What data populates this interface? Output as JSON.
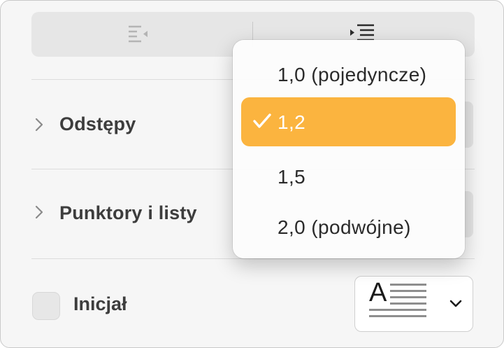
{
  "indent": {
    "decrease_icon": "decrease-indent-icon",
    "increase_icon": "increase-indent-icon"
  },
  "sections": [
    {
      "label": "Odstępy",
      "icon": "chevron-right-icon"
    },
    {
      "label": "Punktory i listy",
      "icon": "chevron-right-icon"
    }
  ],
  "initial": {
    "label": "Inicjał",
    "checked": false,
    "style_preview_letter": "A",
    "dropdown_icon": "chevron-down-icon"
  },
  "spacing_menu": {
    "items": [
      {
        "label": "1,0 (pojedyncze)",
        "selected": false
      },
      {
        "label": "1,2",
        "selected": true
      },
      {
        "label": "1,5",
        "selected": false
      },
      {
        "label": "2,0 (podwójne)",
        "selected": false
      }
    ],
    "selected_icon": "checkmark-icon"
  },
  "colors": {
    "accent": "#fbb43f",
    "background": "#f6f6f6",
    "label": "#3d3d3d"
  }
}
